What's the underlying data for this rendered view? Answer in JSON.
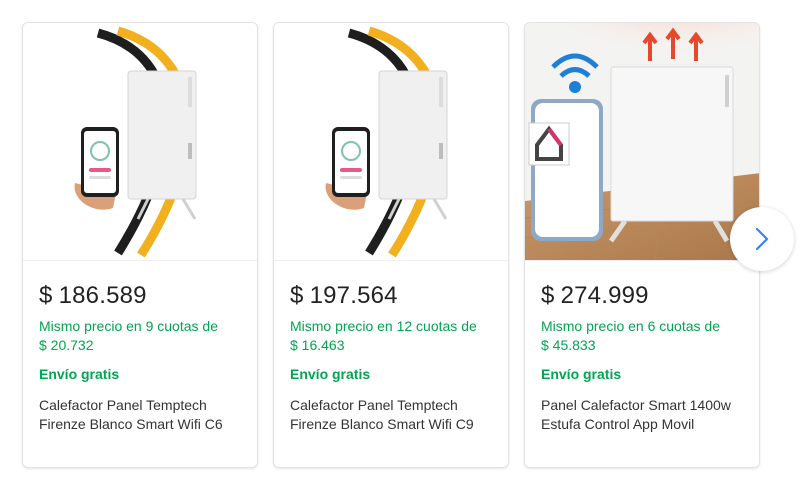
{
  "products": [
    {
      "currency": "$",
      "price": "186.589",
      "installments_line1": "Mismo precio en 9 cuotas de",
      "installments_line2": "$ 20.732",
      "shipping": "Envío gratis",
      "title": "Calefactor Panel Temptech Firenze Blanco Smart Wifi C6",
      "image_icon": "heater-panel-phone-icon"
    },
    {
      "currency": "$",
      "price": "197.564",
      "installments_line1": "Mismo precio en 12 cuotas de",
      "installments_line2": "$ 16.463",
      "shipping": "Envío gratis",
      "title": "Calefactor Panel Temptech Firenze Blanco Smart Wifi C9",
      "image_icon": "heater-panel-phone-icon"
    },
    {
      "currency": "$",
      "price": "274.999",
      "installments_line1": "Mismo precio en 6 cuotas de",
      "installments_line2": "$ 45.833",
      "shipping": "Envío gratis",
      "title": "Panel Calefactor Smart 1400w Estufa Control App Movil",
      "image_icon": "smart-heater-wifi-icon"
    }
  ],
  "navigation": {
    "next_icon": "chevron-right-icon"
  },
  "colors": {
    "price_text": "#222222",
    "installments_green": "#00a650",
    "shipping_green": "#00a650",
    "title_text": "#333333",
    "nav_arrow": "#3483fa"
  }
}
